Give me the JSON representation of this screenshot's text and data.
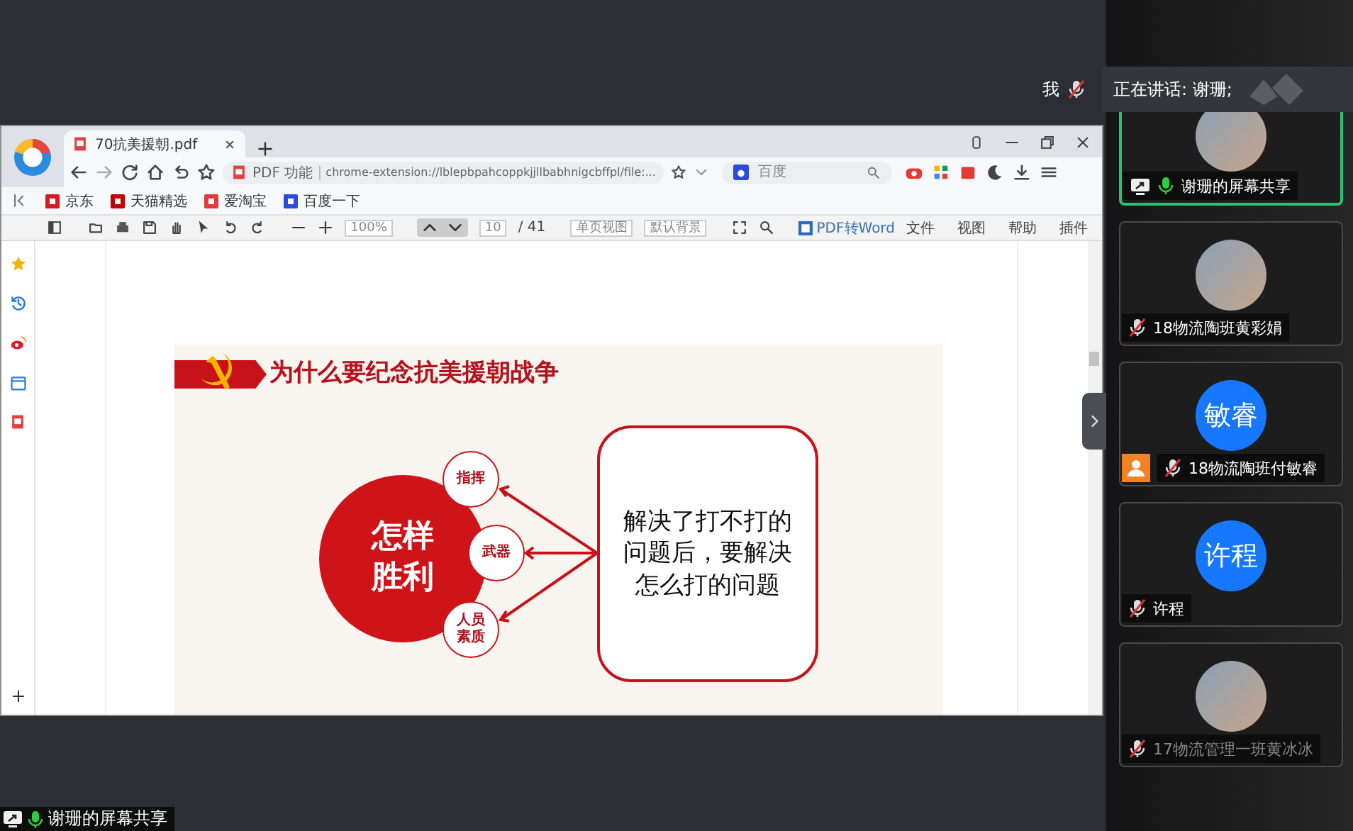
{
  "meeting_status": {
    "self_label": "我",
    "self_muted": true,
    "speaking_text": "正在讲话: 谢珊;"
  },
  "browser": {
    "tab": {
      "title": "70抗美援朝.pdf",
      "selected": true
    },
    "address": {
      "badge": "PDF 功能",
      "url": "chrome-extension://lblepbpahcoppkjjllbabhnigcbffpl/file:..."
    },
    "search": {
      "placeholder": "百度"
    },
    "bookmarks": [
      {
        "label": "京东",
        "kind": "jd"
      },
      {
        "label": "天猫精选",
        "kind": "tmall"
      },
      {
        "label": "爱淘宝",
        "kind": "taobao"
      },
      {
        "label": "百度一下",
        "kind": "baidu"
      }
    ],
    "pdf_toolbar": {
      "zoom": "100%",
      "page": "10",
      "page_total": "/ 41",
      "view_mode": "单页视图",
      "background": "默认背景",
      "convert": "PDF转Word",
      "menus": [
        "文件",
        "视图",
        "帮助",
        "插件"
      ]
    },
    "slide": {
      "title": "为什么要纪念抗美援朝战争",
      "center": "怎样胜利",
      "factors": [
        "指挥",
        "武器",
        "人员素质"
      ],
      "note": "解决了打不打的问题后，要解决怎么打的问题"
    }
  },
  "participants": [
    {
      "name": "谢珊的屏幕共享",
      "kind": "photo",
      "muted": false,
      "speaking": true,
      "sharing": true,
      "host": false,
      "dimmed": false
    },
    {
      "name": "18物流陶班黄彩娟",
      "kind": "photo",
      "muted": true,
      "speaking": false,
      "sharing": false,
      "host": false,
      "dimmed": false
    },
    {
      "name": "18物流陶班付敏睿",
      "kind": "initials",
      "initials": "敏睿",
      "muted": true,
      "speaking": false,
      "sharing": false,
      "host": true,
      "dimmed": false
    },
    {
      "name": "许程",
      "kind": "initials",
      "initials": "许程",
      "muted": true,
      "speaking": false,
      "sharing": false,
      "host": false,
      "dimmed": false
    },
    {
      "name": "17物流管理一班黄冰冰",
      "kind": "photo",
      "muted": true,
      "speaking": false,
      "sharing": false,
      "host": false,
      "dimmed": true
    }
  ],
  "share_label": {
    "text": "谢珊的屏幕共享",
    "muted": false
  }
}
